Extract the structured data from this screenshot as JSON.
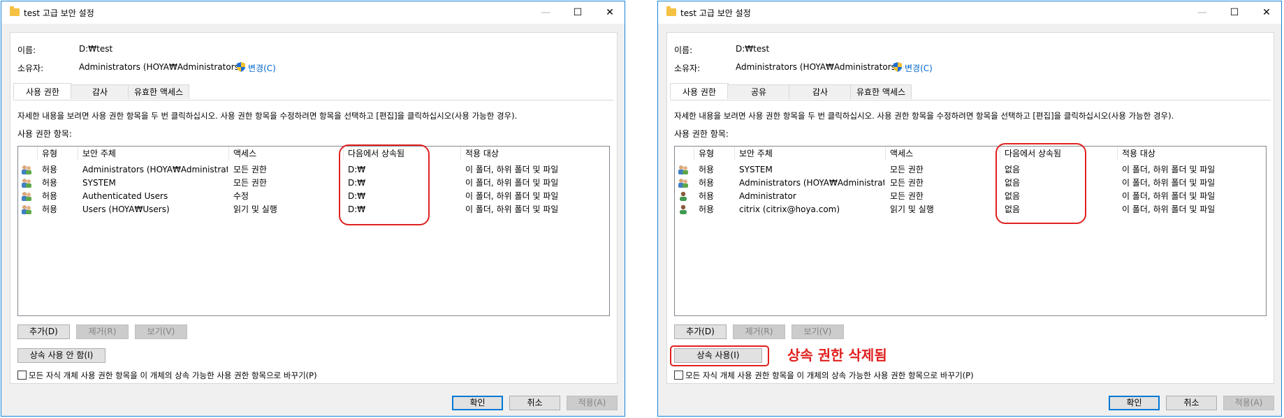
{
  "left": {
    "title": "test 고급 보안 설정",
    "name_label": "이름:",
    "name_value": "D:₩test",
    "owner_label": "소유자:",
    "owner_value": "Administrators (HOYA₩Administrators)",
    "change_link": "변경(C)",
    "tabs": [
      "사용 권한",
      "감사",
      "유효한 액세스"
    ],
    "description": "자세한 내용을 보려면 사용 권한 항목을 두 번 클릭하십시오. 사용 권한 항목을 수정하려면 항목을 선택하고 [편집]을 클릭하십시오(사용 가능한 경우).",
    "entries_label": "사용 권한 항목:",
    "columns": [
      "유형",
      "보안 주체",
      "액세스",
      "다음에서 상속됨",
      "적용 대상"
    ],
    "rows": [
      {
        "type": "허용",
        "principal": "Administrators (HOYA₩Administrat...",
        "access": "모든 권한",
        "inherited": "D:₩",
        "applies": "이 폴더, 하위 폴더 및 파일",
        "icon": "group-icon"
      },
      {
        "type": "허용",
        "principal": "SYSTEM",
        "access": "모든 권한",
        "inherited": "D:₩",
        "applies": "이 폴더, 하위 폴더 및 파일",
        "icon": "group-icon"
      },
      {
        "type": "허용",
        "principal": "Authenticated Users",
        "access": "수정",
        "inherited": "D:₩",
        "applies": "이 폴더, 하위 폴더 및 파일",
        "icon": "group-icon"
      },
      {
        "type": "허용",
        "principal": "Users (HOYA₩Users)",
        "access": "읽기 및 실행",
        "inherited": "D:₩",
        "applies": "이 폴더, 하위 폴더 및 파일",
        "icon": "group-icon"
      }
    ],
    "add_btn": "추가(D)",
    "remove_btn": "제거(R)",
    "view_btn": "보기(V)",
    "inherit_btn": "상속 사용 안 함(I)",
    "replace_checkbox": "모든 자식 개체 사용 권한 항목을 이 개체의 상속 가능한 사용 권한 항목으로 바꾸기(P)",
    "ok_btn": "확인",
    "cancel_btn": "취소",
    "apply_btn": "적용(A)"
  },
  "right": {
    "title": "test 고급 보안 설정",
    "name_label": "이름:",
    "name_value": "D:₩test",
    "owner_label": "소유자:",
    "owner_value": "Administrators (HOYA₩Administrators)",
    "change_link": "변경(C)",
    "tabs": [
      "사용 권한",
      "공유",
      "감사",
      "유효한 액세스"
    ],
    "description": "자세한 내용을 보려면 사용 권한 항목을 두 번 클릭하십시오. 사용 권한 항목을 수정하려면 항목을 선택하고 [편집]을 클릭하십시오(사용 가능한 경우).",
    "entries_label": "사용 권한 항목:",
    "columns": [
      "유형",
      "보안 주체",
      "액세스",
      "다음에서 상속됨",
      "적용 대상"
    ],
    "rows": [
      {
        "type": "허용",
        "principal": "SYSTEM",
        "access": "모든 권한",
        "inherited": "없음",
        "applies": "이 폴더, 하위 폴더 및 파일",
        "icon": "group-icon"
      },
      {
        "type": "허용",
        "principal": "Administrators (HOYA₩Administrat...",
        "access": "모든 권한",
        "inherited": "없음",
        "applies": "이 폴더, 하위 폴더 및 파일",
        "icon": "group-icon"
      },
      {
        "type": "허용",
        "principal": "Administrator",
        "access": "모든 권한",
        "inherited": "없음",
        "applies": "이 폴더, 하위 폴더 및 파일",
        "icon": "user-icon"
      },
      {
        "type": "허용",
        "principal": "citrix (citrix@hoya.com)",
        "access": "읽기 및 실행",
        "inherited": "없음",
        "applies": "이 폴더, 하위 폴더 및 파일",
        "icon": "user-icon"
      }
    ],
    "add_btn": "추가(D)",
    "remove_btn": "제거(R)",
    "view_btn": "보기(V)",
    "inherit_btn": "상속 사용(I)",
    "replace_checkbox": "모든 자식 개체 사용 권한 항목을 이 개체의 상속 가능한 사용 권한 항목으로 바꾸기(P)",
    "ok_btn": "확인",
    "cancel_btn": "취소",
    "apply_btn": "적용(A)",
    "annotation": "상속 권한 삭제됨"
  },
  "colors": {
    "accent": "#0078d7",
    "link": "#0066cc",
    "annotation": "#e0201f"
  }
}
